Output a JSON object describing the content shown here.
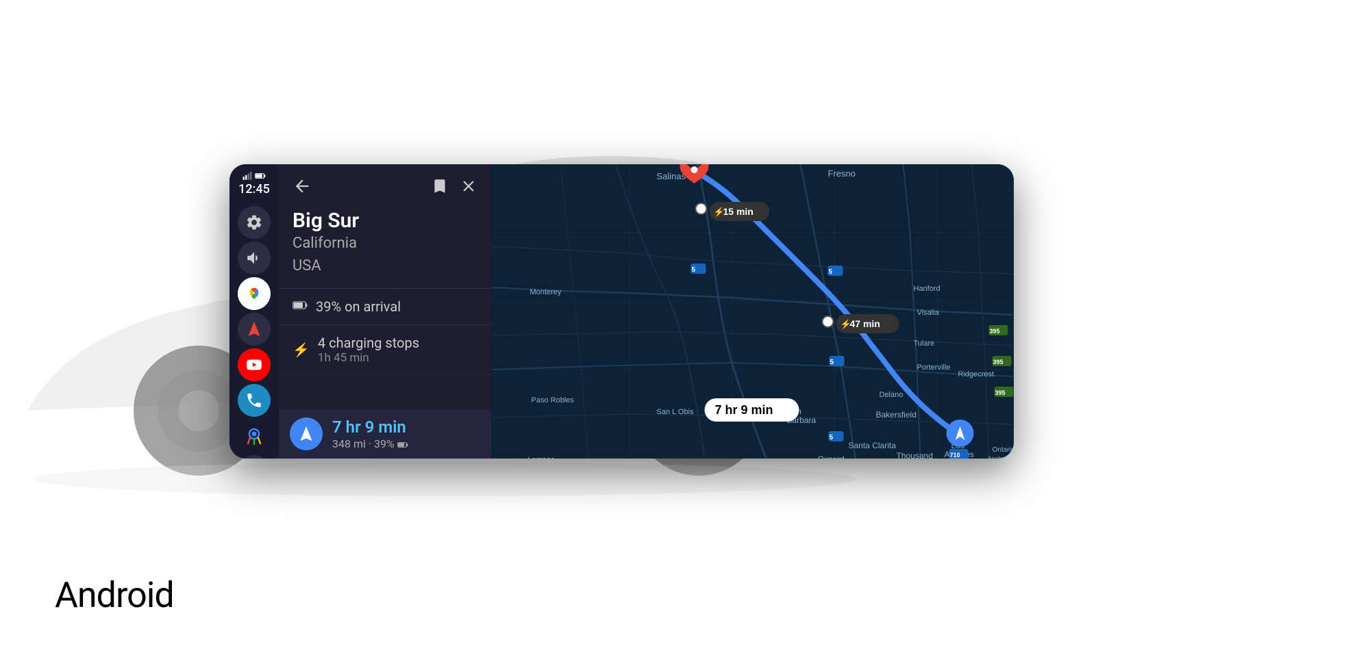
{
  "android_label": "Android",
  "time": "12:45",
  "sidebar": {
    "settings_icon": "gear-icon",
    "volume_icon": "volume-icon",
    "maps_icon": "google-maps-icon",
    "navigate_icon": "navigation-icon",
    "youtube_icon": "youtube-icon",
    "phone_icon": "phone-icon",
    "assistant_icon": "google-assistant-icon",
    "zoom_in": "+",
    "zoom_out": "−",
    "grid_icon": "grid-icon"
  },
  "panel": {
    "back_label": "←",
    "bookmark_label": "🔖",
    "close_label": "✕",
    "destination": {
      "name": "Big Sur",
      "state": "California",
      "country": "USA"
    },
    "battery_arrival": "39% on arrival",
    "charging": {
      "icon": "⚡",
      "stops": "4 charging stops",
      "duration": "1h 45 min"
    },
    "nav": {
      "time": "7 hr 9 min",
      "distance": "348 mi · 39%",
      "battery_icon": "🔋"
    }
  },
  "map": {
    "label_15min": "⚡ 15 min",
    "label_47min": "⚡ 47 min",
    "label_main": "7 hr 9 min",
    "route_color": "#4285f4"
  },
  "colors": {
    "bg_dark": "#1a1a2e",
    "panel_bg": "#1e1e30",
    "map_bg": "#0d2137",
    "accent_blue": "#4285f4",
    "accent_cyan": "#4fc3f7",
    "text_primary": "#ffffff",
    "text_secondary": "#aaaaaa"
  }
}
